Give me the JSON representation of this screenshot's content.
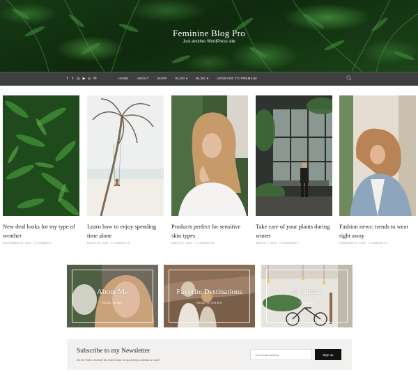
{
  "site": {
    "title": "Feminine Blog Pro",
    "tagline": "Just another WordPress site"
  },
  "nav": {
    "social_icons": [
      "facebook-icon",
      "twitter-icon",
      "instagram-icon",
      "youtube-icon",
      "pinterest-icon",
      "email-icon"
    ],
    "items": [
      "HOME",
      "ABOUT",
      "SHOP",
      "BLOG ▾",
      "BLOG ▾",
      "UPGRADE TO PREMIUM"
    ]
  },
  "posts": [
    {
      "title": "New deal looks for my type of weather",
      "meta": "NOVEMBER 22, 2023 · 0 COMMENT"
    },
    {
      "title": "Learn how to enjoy spending time alone",
      "meta": "MARCH 6, 2023 · 0 COMMENTS"
    },
    {
      "title": "Products perfect for sensitive skin types",
      "meta": "MARCH 7, 2023 · 0 COMMENTS"
    },
    {
      "title": "Take care of your plants during winter",
      "meta": "MARCH 3, 2023 · 0 COMMENTS"
    },
    {
      "title": "Fashion news: trends to wear right away",
      "meta": "FEBRUARY 5, 2023 · 0 COMMENTS"
    }
  ],
  "promos": [
    {
      "label": "About Me",
      "sub": "READ MORE"
    },
    {
      "label": "Favorite Destinations",
      "sub": "READ STORIES"
    },
    {
      "label": "Instagram",
      "sub": "FOLLOW"
    }
  ],
  "newsletter": {
    "title": "Subscribe to my Newsletter",
    "desc": "Be the first to receive the latest buzz on upcoming contests & more!",
    "placeholder": "Your email address",
    "button": "Sign up"
  },
  "colors": {
    "nav_bg": "#3d403e",
    "newsletter_bg": "#f2f1ef",
    "button_bg": "#111111"
  }
}
